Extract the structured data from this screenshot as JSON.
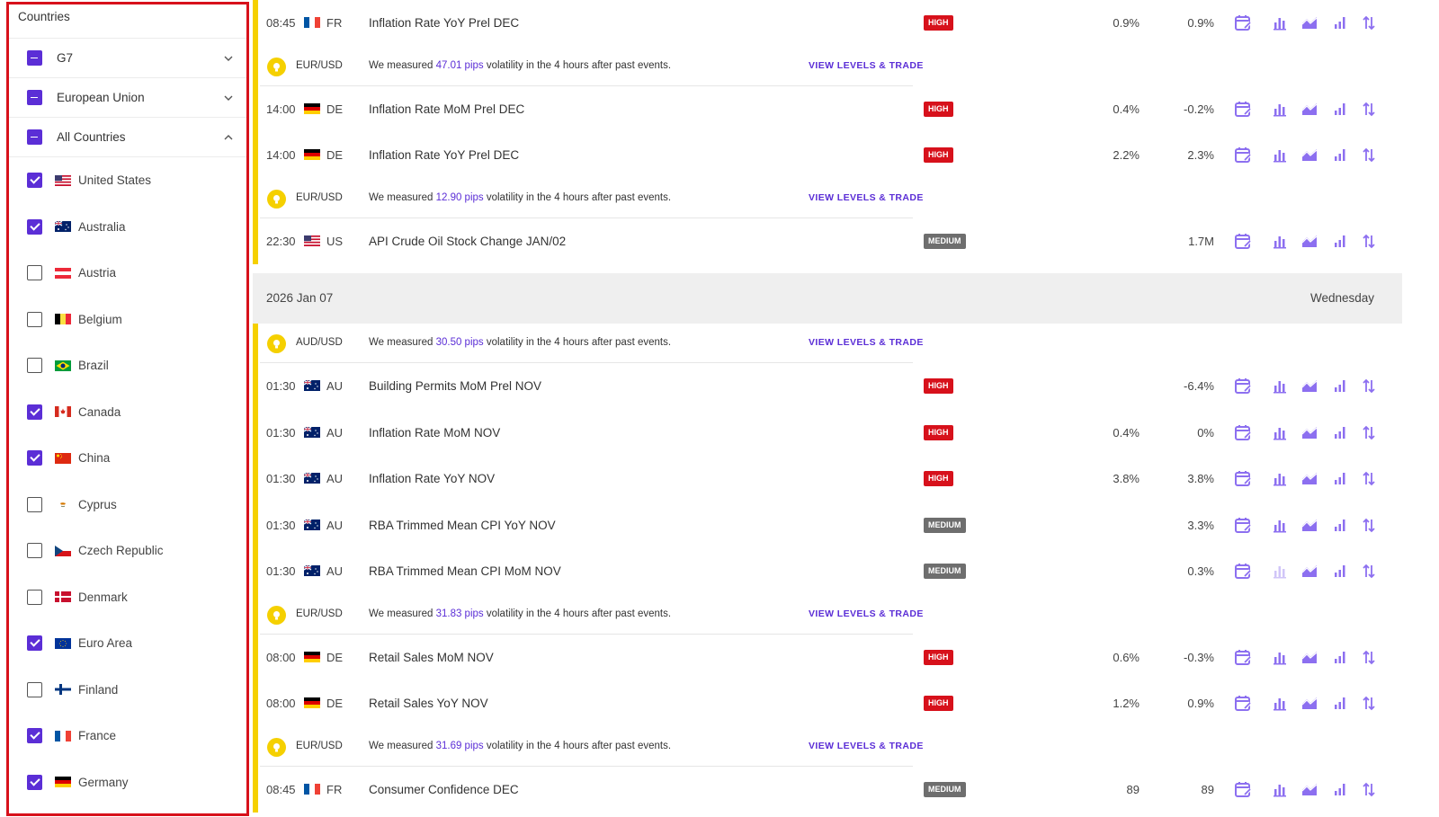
{
  "sidebar": {
    "title": "Countries",
    "groups": [
      {
        "label": "G7",
        "state": "indeterminate",
        "expanded": false
      },
      {
        "label": "European Union",
        "state": "indeterminate",
        "expanded": false
      },
      {
        "label": "All Countries",
        "state": "indeterminate",
        "expanded": true
      }
    ],
    "countries": [
      {
        "name": "United States",
        "checked": true,
        "flag": "us-flag"
      },
      {
        "name": "Australia",
        "checked": true,
        "flag": "au-flag"
      },
      {
        "name": "Austria",
        "checked": false,
        "flag": "at-flag"
      },
      {
        "name": "Belgium",
        "checked": false,
        "flag": "be-flag"
      },
      {
        "name": "Brazil",
        "checked": false,
        "flag": "br-flag"
      },
      {
        "name": "Canada",
        "checked": true,
        "flag": "ca-flag"
      },
      {
        "name": "China",
        "checked": true,
        "flag": "cn-flag"
      },
      {
        "name": "Cyprus",
        "checked": false,
        "flag": "cy-flag"
      },
      {
        "name": "Czech Republic",
        "checked": false,
        "flag": "cz-flag"
      },
      {
        "name": "Denmark",
        "checked": false,
        "flag": "dk-flag"
      },
      {
        "name": "Euro Area",
        "checked": true,
        "flag": "eu-flag"
      },
      {
        "name": "Finland",
        "checked": false,
        "flag": "fi-flag"
      },
      {
        "name": "France",
        "checked": true,
        "flag": "fr-flag"
      },
      {
        "name": "Germany",
        "checked": true,
        "flag": "de-flag"
      }
    ]
  },
  "calendar": {
    "rows": [
      {
        "kind": "event",
        "time": "08:45",
        "flag": "fr-flag",
        "country": "FR",
        "event": "Inflation Rate YoY Prel DEC",
        "impact": "HIGH",
        "previous": "0.9%",
        "consensus": "0.9%",
        "bar": true
      },
      {
        "kind": "vol",
        "pair": "EUR/USD",
        "pre": "We measured ",
        "pips": "47.01 pips",
        "post": " volatility in the 4 hours after past events.",
        "cta": "VIEW LEVELS & TRADE",
        "bar": true
      },
      {
        "kind": "event",
        "time": "14:00",
        "flag": "de-flag",
        "country": "DE",
        "event": "Inflation Rate MoM Prel DEC",
        "impact": "HIGH",
        "previous": "0.4%",
        "consensus": "-0.2%",
        "bar": true
      },
      {
        "kind": "event",
        "time": "14:00",
        "flag": "de-flag",
        "country": "DE",
        "event": "Inflation Rate YoY Prel DEC",
        "impact": "HIGH",
        "previous": "2.2%",
        "consensus": "2.3%",
        "bar": true
      },
      {
        "kind": "vol",
        "pair": "EUR/USD",
        "pre": "We measured ",
        "pips": "12.90 pips",
        "post": " volatility in the 4 hours after past events.",
        "cta": "VIEW LEVELS & TRADE",
        "bar": true
      },
      {
        "kind": "event",
        "time": "22:30",
        "flag": "us-flag",
        "country": "US",
        "event": "API Crude Oil Stock Change JAN/02",
        "impact": "MEDIUM",
        "previous": "",
        "consensus": "1.7M",
        "bar": true
      },
      {
        "kind": "spacer"
      },
      {
        "kind": "date",
        "date": "2026 Jan 07",
        "day": "Wednesday"
      },
      {
        "kind": "vol",
        "pair": "AUD/USD",
        "pre": "We measured ",
        "pips": "30.50 pips",
        "post": " volatility in the 4 hours after past events.",
        "cta": "VIEW LEVELS & TRADE",
        "bar": true
      },
      {
        "kind": "event",
        "time": "01:30",
        "flag": "au-flag",
        "country": "AU",
        "event": "Building Permits MoM Prel NOV",
        "impact": "HIGH",
        "previous": "",
        "consensus": "-6.4%",
        "bar": true
      },
      {
        "kind": "event",
        "time": "01:30",
        "flag": "au-flag",
        "country": "AU",
        "event": "Inflation Rate MoM NOV",
        "impact": "HIGH",
        "previous": "0.4%",
        "consensus": "0%",
        "bar": true
      },
      {
        "kind": "event",
        "time": "01:30",
        "flag": "au-flag",
        "country": "AU",
        "event": "Inflation Rate YoY NOV",
        "impact": "HIGH",
        "previous": "3.8%",
        "consensus": "3.8%",
        "bar": true
      },
      {
        "kind": "event",
        "time": "01:30",
        "flag": "au-flag",
        "country": "AU",
        "event": "RBA Trimmed Mean CPI YoY NOV",
        "impact": "MEDIUM",
        "previous": "",
        "consensus": "3.3%",
        "bar": true
      },
      {
        "kind": "event",
        "time": "01:30",
        "flag": "au-flag",
        "country": "AU",
        "event": "RBA Trimmed Mean CPI MoM NOV",
        "impact": "MEDIUM",
        "previous": "",
        "consensus": "0.3%",
        "bar": true,
        "faded_chart_icon": true
      },
      {
        "kind": "vol",
        "pair": "EUR/USD",
        "pre": "We measured ",
        "pips": "31.83 pips",
        "post": " volatility in the 4 hours after past events.",
        "cta": "VIEW LEVELS & TRADE",
        "bar": true
      },
      {
        "kind": "event",
        "time": "08:00",
        "flag": "de-flag",
        "country": "DE",
        "event": "Retail Sales MoM NOV",
        "impact": "HIGH",
        "previous": "0.6%",
        "consensus": "-0.3%",
        "bar": true
      },
      {
        "kind": "event",
        "time": "08:00",
        "flag": "de-flag",
        "country": "DE",
        "event": "Retail Sales YoY NOV",
        "impact": "HIGH",
        "previous": "1.2%",
        "consensus": "0.9%",
        "bar": true
      },
      {
        "kind": "vol",
        "pair": "EUR/USD",
        "pre": "We measured ",
        "pips": "31.69 pips",
        "post": " volatility in the 4 hours after past events.",
        "cta": "VIEW LEVELS & TRADE",
        "bar": true
      },
      {
        "kind": "event",
        "time": "08:45",
        "flag": "fr-flag",
        "country": "FR",
        "event": "Consumer Confidence DEC",
        "impact": "MEDIUM",
        "previous": "89",
        "consensus": "89",
        "bar": true
      }
    ],
    "row_icons": [
      "calendar-edit-icon",
      "bar-chart-icon",
      "area-chart-icon",
      "signal-chart-icon",
      "sort-arrows-icon"
    ]
  },
  "colors": {
    "accent": "#5b2ed6",
    "high": "#d7111b",
    "medium": "#6e6e6e",
    "bar": "#f5d000",
    "outline": "#d7111b"
  }
}
